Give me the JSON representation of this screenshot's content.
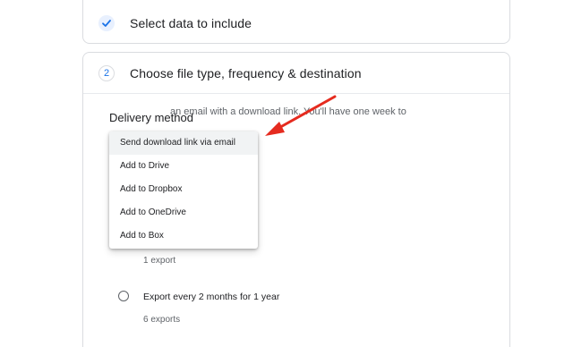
{
  "steps": [
    {
      "number": "",
      "title": "Select data to include",
      "state": "done",
      "icon": "check-icon"
    },
    {
      "number": "2",
      "title": "Choose file type, frequency & destination",
      "state": "active"
    }
  ],
  "delivery": {
    "label": "Delivery method",
    "description_fragment": "an email with a download link. You'll have one week to",
    "menu_items": [
      "Send download link via email",
      "Add to Drive",
      "Add to Dropbox",
      "Add to OneDrive",
      "Add to Box"
    ],
    "selected_index": 0
  },
  "frequency": {
    "options": [
      {
        "label": "",
        "sub": "1 export",
        "selected": false
      },
      {
        "label": "Export every 2 months for 1 year",
        "sub": "6 exports",
        "selected": false
      }
    ]
  },
  "colors": {
    "accent": "#1a73e8",
    "arrow": "#e52b1f",
    "border": "#dadce0"
  }
}
